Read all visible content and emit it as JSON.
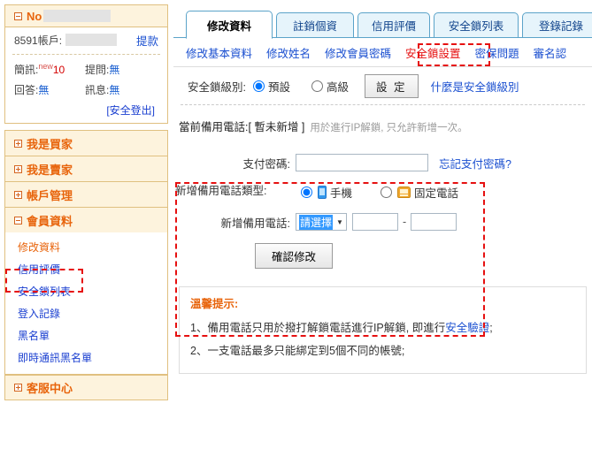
{
  "sidebar": {
    "user_header": {
      "prefix": "No",
      "redacted": true
    },
    "account": {
      "label": "8591帳戶:",
      "value_redacted": true,
      "action": "提款"
    },
    "stats": [
      {
        "label": "簡訊:",
        "badge": "new",
        "value": "10"
      },
      {
        "label": "提問:",
        "value": "無"
      },
      {
        "label": "回答:",
        "value": "無"
      },
      {
        "label": "訊息:",
        "value": "無"
      }
    ],
    "logout": "[安全登出]",
    "sections": [
      {
        "label": "我是買家",
        "state": "collapsed"
      },
      {
        "label": "我是賣家",
        "state": "collapsed"
      },
      {
        "label": "帳戶管理",
        "state": "collapsed"
      },
      {
        "label": "會員資料",
        "state": "expanded",
        "items": [
          {
            "label": "修改資料",
            "current": true
          },
          {
            "label": "信用評價",
            "current": false
          },
          {
            "label": "安全鎖列表",
            "current": false
          },
          {
            "label": "登入記錄",
            "current": false
          },
          {
            "label": "黑名單",
            "current": false
          },
          {
            "label": "即時通訊黑名單",
            "current": false
          }
        ]
      },
      {
        "label": "客服中心",
        "state": "collapsed"
      }
    ]
  },
  "main": {
    "tabs": [
      {
        "label": "修改資料",
        "active": true
      },
      {
        "label": "註銷個資",
        "active": false
      },
      {
        "label": "信用評價",
        "active": false
      },
      {
        "label": "安全鎖列表",
        "active": false
      },
      {
        "label": "登錄記錄",
        "active": false
      }
    ],
    "submenu": [
      {
        "label": "修改基本資料",
        "selected": false
      },
      {
        "label": "修改姓名",
        "selected": false
      },
      {
        "label": "修改會員密碼",
        "selected": false
      },
      {
        "label": "安全鎖設置",
        "selected": true
      },
      {
        "label": "密保問題",
        "selected": false
      },
      {
        "label": "審名認",
        "selected": false
      }
    ],
    "lock_level": {
      "label": "安全鎖級別:",
      "options": [
        {
          "label": "預設",
          "checked": true
        },
        {
          "label": "高級",
          "checked": false
        }
      ],
      "button": "設 定",
      "help_link": "什麼是安全鎖級別"
    },
    "current_backup_phone": {
      "label": "當前備用電話:",
      "value": "[ 暫未新增 ]",
      "note": "用於進行IP解鎖, 只允許新增一次。"
    },
    "form": {
      "pay_password": {
        "label": "支付密碼:",
        "value": "",
        "placeholder": "",
        "forgot_link": "忘記支付密碼?"
      },
      "phone_type": {
        "label": "新增備用電話類型:",
        "options": [
          {
            "label": "手機",
            "icon": "mobile-phone-icon",
            "checked": true
          },
          {
            "label": "固定電話",
            "icon": "telephone-icon",
            "checked": false
          }
        ]
      },
      "new_phone": {
        "label": "新增備用電話:",
        "select_value": "請選擇",
        "part1": "",
        "part2": "",
        "separator": "-"
      },
      "submit": "確認修改"
    },
    "tips": {
      "title": "溫馨提示:",
      "items": [
        {
          "prefix": "1、備用電話只用於撥打解鎖電話進行IP解鎖, 即進行",
          "link": "安全驗證",
          "suffix": ";"
        },
        {
          "prefix": "2、一支電話最多只能綁定到5個不同的帳號;",
          "link": "",
          "suffix": ""
        }
      ]
    }
  },
  "highlights": {
    "accent_red": "#e61010",
    "brand_orange": "#e8650d",
    "link_blue": "#1a4fd0"
  }
}
